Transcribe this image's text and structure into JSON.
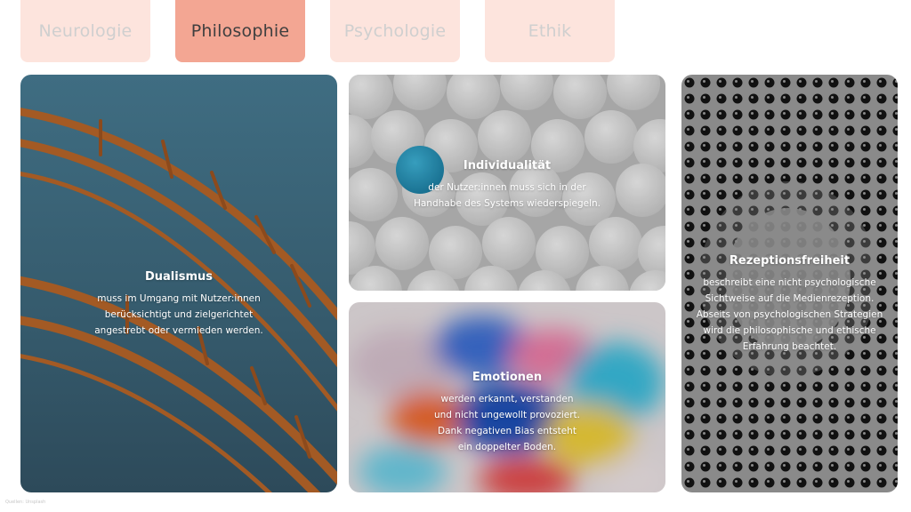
{
  "tabs": [
    {
      "label": "Neurologie",
      "active": false
    },
    {
      "label": "Philosophie",
      "active": true
    },
    {
      "label": "Psychologie",
      "active": false
    },
    {
      "label": "Ethik",
      "active": false
    }
  ],
  "cards": {
    "dualismus": {
      "title": "Dualismus",
      "text": "muss im Umgang mit Nutzer:innen\nberücksichtigt und zielgerichtet\nangestrebt oder vermieden werden."
    },
    "individualitaet": {
      "title": "Individualität",
      "text": "der Nutzer:innen muss sich in der\nHandhabe des Systems wiederspiegeln."
    },
    "emotionen": {
      "title": "Emotionen",
      "text": "werden erkannt, verstanden\nund nicht ungewollt provoziert.\nDank negativen Bias entsteht\nein doppelter Boden."
    },
    "rezeptionsfreiheit": {
      "title": "Rezeptionsfreiheit",
      "text": "beschreibt eine nicht psychologische\nSichtweise auf die Medienrezeption.\nAbseits von psychologischen Strategien\nwird die philosophische und ethische\nErfahrung beachtet."
    }
  },
  "footer": {
    "credit": "Quellen: Unsplash"
  },
  "colors": {
    "tab_inactive": "#fde4dd",
    "tab_active": "#f3a693",
    "card_overlay": "#8a8a8a"
  }
}
